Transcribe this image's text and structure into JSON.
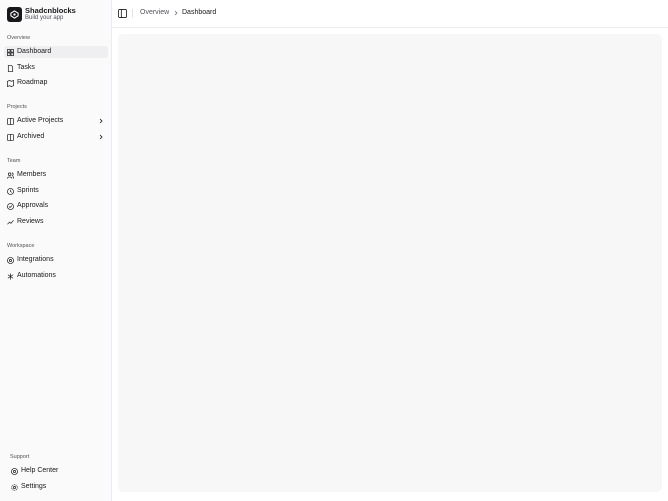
{
  "brand": {
    "name": "Shadcnblocks",
    "subtitle": "Build your app"
  },
  "sidebar": {
    "overview": {
      "label": "Overview",
      "items": [
        {
          "label": "Dashboard",
          "icon": "layout-grid-icon",
          "active": true
        },
        {
          "label": "Tasks",
          "icon": "file-icon"
        },
        {
          "label": "Roadmap",
          "icon": "map-icon"
        }
      ]
    },
    "projects": {
      "label": "Projects",
      "items": [
        {
          "label": "Active Projects",
          "icon": "grid-icon"
        },
        {
          "label": "Archived",
          "icon": "grid-icon"
        }
      ]
    },
    "team": {
      "label": "Team",
      "items": [
        {
          "label": "Members",
          "icon": "users-icon"
        },
        {
          "label": "Sprints",
          "icon": "clock-icon"
        },
        {
          "label": "Approvals",
          "icon": "check-circle-icon"
        },
        {
          "label": "Reviews",
          "icon": "chart-icon"
        }
      ]
    },
    "workspace": {
      "label": "Workspace",
      "items": [
        {
          "label": "Integrations",
          "icon": "plug-icon"
        },
        {
          "label": "Automations",
          "icon": "zap-icon"
        }
      ]
    },
    "support": {
      "label": "Support",
      "items": [
        {
          "label": "Help Center",
          "icon": "help-circle-icon"
        },
        {
          "label": "Settings",
          "icon": "gear-icon"
        }
      ]
    }
  },
  "header": {
    "breadcrumb": {
      "parent": "Overview",
      "current": "Dashboard"
    }
  },
  "colors": {
    "active_bg": "#efeff1",
    "logo_bg": "#18181b",
    "panel_bg": "#f7f7f8"
  }
}
